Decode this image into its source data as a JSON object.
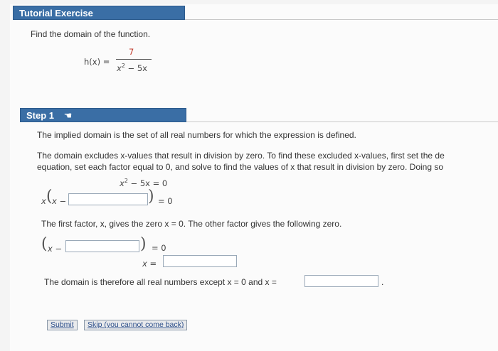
{
  "header": {
    "title": "Tutorial Exercise"
  },
  "problem": {
    "prompt": "Find the domain of the function.",
    "fn_lhs": "h(x) =",
    "numerator": "7",
    "denominator_var": "x",
    "denominator_exp": "2",
    "denominator_rest": " − 5x"
  },
  "step": {
    "title": "Step 1",
    "line1": "The implied domain is the set of all real numbers for which the expression is defined.",
    "line2": "The domain excludes x-values that result in division by zero. To find these excluded x-values, first set the de",
    "line3": "equation, set each factor equal to 0, and solve to find the values of x that result in division by zero. Doing so",
    "eq1_var": "x",
    "eq1_exp": "2",
    "eq1_rest": " − 5x = 0",
    "eq2_prefix": "x",
    "eq2_inner": "x −",
    "eq2_rhs": "= 0",
    "line4": "The first factor, x, gives the zero x = 0. The other factor gives the following zero.",
    "eq3_inner": "x −",
    "eq3_rhs": "= 0",
    "eq4_lhs": "x =",
    "line5": "The domain is therefore all real numbers except x = 0 and x =",
    "period": "."
  },
  "inputs": {
    "eq2_box": "",
    "eq3_box": "",
    "eq4_box": "",
    "final_box": ""
  },
  "buttons": {
    "submit": "Submit",
    "skip": "Skip (you cannot come back)"
  },
  "colors": {
    "header_bg": "#3a6ea5",
    "accent_red": "#c0392b"
  }
}
